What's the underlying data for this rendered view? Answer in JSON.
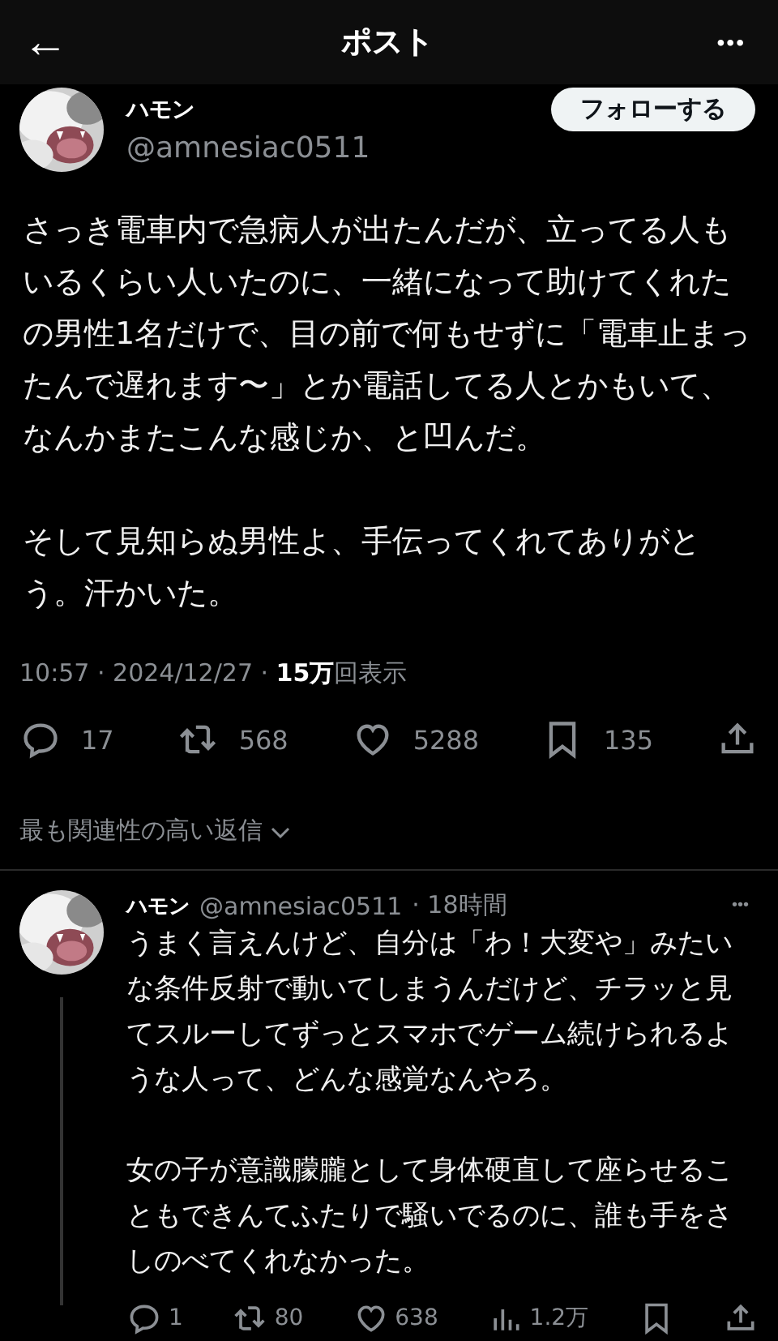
{
  "header": {
    "back": "←",
    "title": "ポスト",
    "more": "•••"
  },
  "post": {
    "author": {
      "name": "ハモン",
      "handle": "@amnesiac0511"
    },
    "follow_button": "フォローする",
    "paragraphs": [
      "さっき電車内で急病人が出たんだが、立ってる人もいるくらい人いたのに、一緒になって助けてくれたの男性1名だけで、目の前で何もせずに「電車止まったんで遅れます〜」とか電話してる人とかもいて、なんかまたこんな感じか、と凹んだ。",
      "そして見知らぬ男性よ、手伝ってくれてありがとう。汗かいた。"
    ],
    "meta": "10:57 · 2024/12/27 · **15万**回表示",
    "actions": [
      {
        "kind": "reply",
        "count": "17"
      },
      {
        "kind": "repost",
        "count": "568"
      },
      {
        "kind": "like",
        "count": "5288"
      },
      {
        "kind": "bookmark",
        "count": "135"
      },
      {
        "kind": "share"
      }
    ]
  },
  "sort": {
    "label": "最も関連性の高い返信"
  },
  "reply": {
    "name": "ハモン",
    "handle": "@amnesiac0511",
    "time": "· 18時間",
    "paragraphs": [
      "うまく言えんけど、自分は「わ！大変や」みたいな条件反射で動いてしまうんだけど、チラッと見てスルーしてずっとスマホでゲーム続けられるような人って、どんな感覚なんやろ。",
      "女の子が意識朦朧として身体硬直して座らせることもできんてふたりで騒いでるのに、誰も手をさしのべてくれなかった。"
    ],
    "actions": [
      {
        "kind": "reply",
        "count": "1"
      },
      {
        "kind": "repost",
        "count": "80"
      },
      {
        "kind": "like",
        "count": "638"
      },
      {
        "kind": "views",
        "count": "1.2万"
      },
      {
        "kind": "bookmark"
      },
      {
        "kind": "share"
      }
    ]
  }
}
